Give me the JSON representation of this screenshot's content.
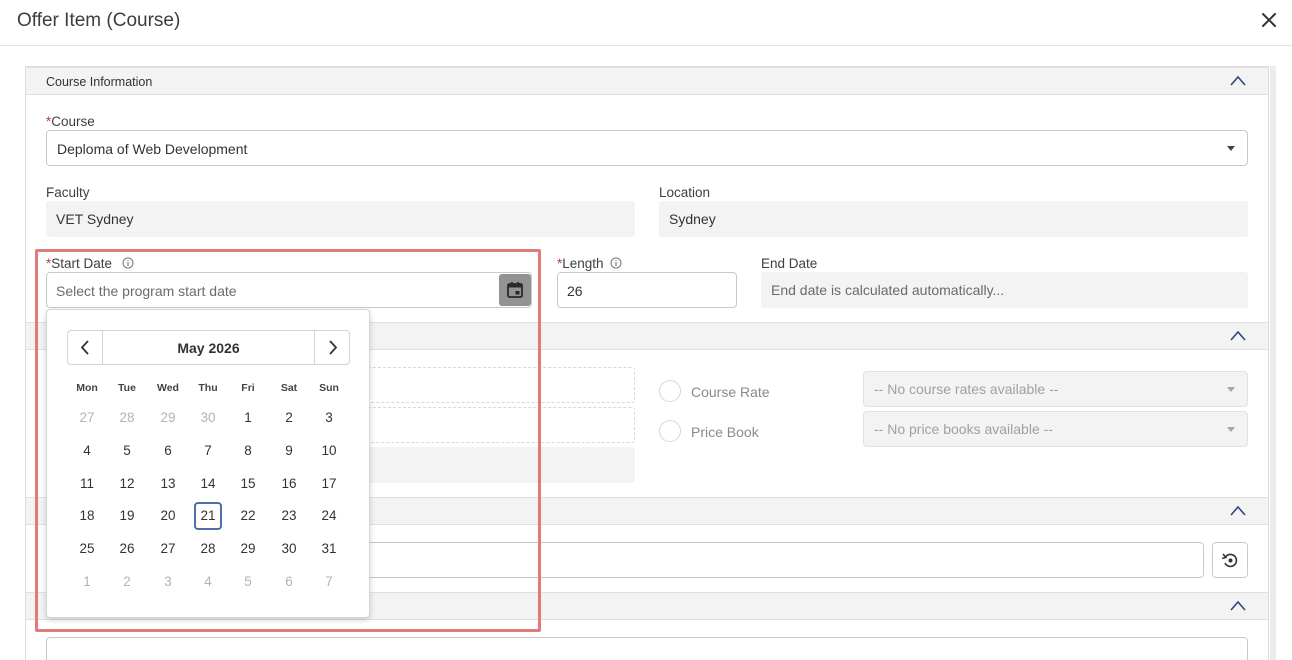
{
  "modal": {
    "title": "Offer Item (Course)"
  },
  "sections": {
    "course_info": {
      "label": "Course Information"
    }
  },
  "course": {
    "label": "Course",
    "value": "Deploma of Web Development"
  },
  "faculty": {
    "label": "Faculty",
    "value": "VET Sydney"
  },
  "location": {
    "label": "Location",
    "value": "Sydney"
  },
  "start_date": {
    "label": "Start Date",
    "placeholder": "Select the program start date"
  },
  "length": {
    "label": "Length",
    "value": "26"
  },
  "end_date": {
    "label": "End Date",
    "placeholder": "End date is calculated automatically..."
  },
  "pricing": {
    "course_rate": {
      "label": "Course Rate",
      "select": "-- No course rates available --"
    },
    "price_book": {
      "label": "Price Book",
      "select": "-- No price books available --"
    }
  },
  "datepicker": {
    "month_label": "May 2026",
    "weekdays": [
      "Mon",
      "Tue",
      "Wed",
      "Thu",
      "Fri",
      "Sat",
      "Sun"
    ],
    "weeks": [
      [
        [
          "27",
          true
        ],
        [
          "28",
          true
        ],
        [
          "29",
          true
        ],
        [
          "30",
          true
        ],
        [
          "1",
          false
        ],
        [
          "2",
          false
        ],
        [
          "3",
          false
        ]
      ],
      [
        [
          "4",
          false
        ],
        [
          "5",
          false
        ],
        [
          "6",
          false
        ],
        [
          "7",
          false
        ],
        [
          "8",
          false
        ],
        [
          "9",
          false
        ],
        [
          "10",
          false
        ]
      ],
      [
        [
          "11",
          false
        ],
        [
          "12",
          false
        ],
        [
          "13",
          false
        ],
        [
          "14",
          false
        ],
        [
          "15",
          false
        ],
        [
          "16",
          false
        ],
        [
          "17",
          false
        ]
      ],
      [
        [
          "18",
          false
        ],
        [
          "19",
          false
        ],
        [
          "20",
          false
        ],
        [
          "21",
          false
        ],
        [
          "22",
          false
        ],
        [
          "23",
          false
        ],
        [
          "24",
          false
        ]
      ],
      [
        [
          "25",
          false
        ],
        [
          "26",
          false
        ],
        [
          "27",
          false
        ],
        [
          "28",
          false
        ],
        [
          "29",
          false
        ],
        [
          "30",
          false
        ],
        [
          "31",
          false
        ]
      ],
      [
        [
          "1",
          true
        ],
        [
          "2",
          true
        ],
        [
          "3",
          true
        ],
        [
          "4",
          true
        ],
        [
          "5",
          true
        ],
        [
          "6",
          true
        ],
        [
          "7",
          true
        ]
      ]
    ],
    "selected_day": "21"
  },
  "colors": {
    "highlight": "#e07b7b",
    "selected_outline": "#4f6fa8",
    "required": "#c23934"
  },
  "icons": {
    "close": "close-icon",
    "section_toggle": "chevron-up-icon",
    "calendar": "calendar-icon",
    "info": "info-icon",
    "refresh": "refresh-icon",
    "prev": "chevron-left-icon",
    "next": "chevron-right-icon"
  }
}
